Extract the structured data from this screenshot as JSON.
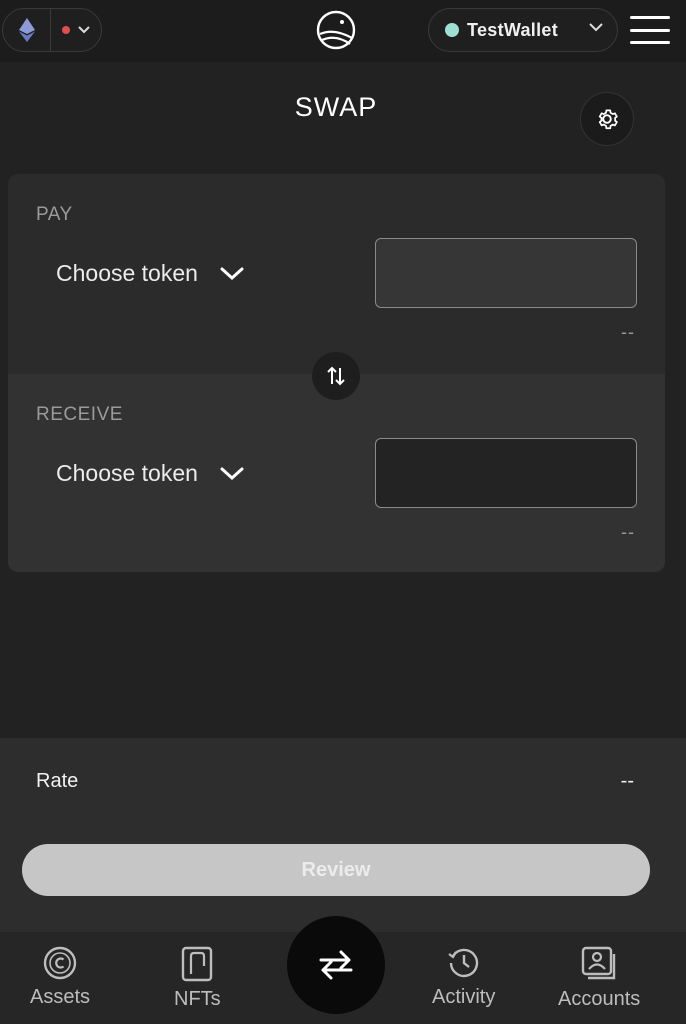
{
  "header": {
    "network_icon": "ethereum-icon",
    "wallet_name": "TestWallet",
    "colors": {
      "wallet_status": "#9ee0d2",
      "network_status": "#e0504a"
    }
  },
  "title": "SWAP",
  "pay": {
    "label": "PAY",
    "token_placeholder": "Choose token",
    "amount": "",
    "fiat_value": "--"
  },
  "receive": {
    "label": "RECEIVE",
    "token_placeholder": "Choose token",
    "amount": "",
    "fiat_value": "--"
  },
  "rate": {
    "label": "Rate",
    "value": "--"
  },
  "review_label": "Review",
  "nav": {
    "assets": "Assets",
    "nfts": "NFTs",
    "activity": "Activity",
    "accounts": "Accounts"
  }
}
